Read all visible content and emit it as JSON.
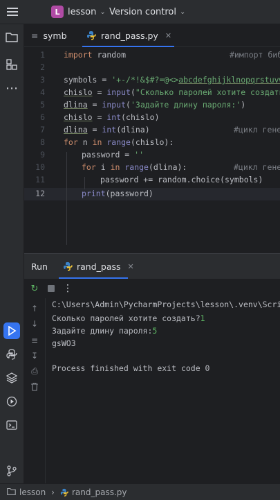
{
  "titlebar": {
    "project_initial": "L",
    "project_name": "lesson",
    "vcs_label": "Version control"
  },
  "editor_tabs": [
    {
      "label": "symb",
      "active": false
    },
    {
      "label": "rand_pass.py",
      "active": true
    }
  ],
  "code": {
    "current_line": 12,
    "line_numbers": [
      "1",
      "2",
      "3",
      "4",
      "5",
      "6",
      "7",
      "8",
      "9",
      "10",
      "11",
      "12"
    ],
    "lines": {
      "l1_kw": "import",
      "l1_mod": " random",
      "l1_comment": "#импорт биб",
      "l3_var": "symbols = ",
      "l3_str_plain": "'+-/*!&$#?=@<>",
      "l3_str_ul": "abcdefghijklnopqrstuvwx",
      "l4_var": "chislo",
      "l4_eq": " = ",
      "l4_fn": "input",
      "l4_str": "\"Сколько паролей хотите создать?",
      "l5_var": "dlina",
      "l5_eq": " = ",
      "l5_fn": "input",
      "l5_str": "'Задайте длину пароля:'",
      "l5_close": ")",
      "l6_var": "chislo",
      "l6_eq": " = ",
      "l6_fn": "int",
      "l6_arg": "(chislo)",
      "l7_var": "dlina",
      "l7_eq": " = ",
      "l7_fn": "int",
      "l7_arg": "(dlina)",
      "l7_comment": "#цикл гене",
      "l8_for": "for",
      "l8_n": " n ",
      "l8_in": "in",
      "l8_range": " range",
      "l8_arg": "(chislo):",
      "l9_code": "password = ",
      "l9_str": "''",
      "l10_for": "for",
      "l10_i": " i ",
      "l10_in": "in",
      "l10_range": " range",
      "l10_arg": "(dlina):",
      "l10_comment": "#цикл гене",
      "l11_code": "password += random.choice(symbols)",
      "l12_fn": "print",
      "l12_arg": "(password)"
    }
  },
  "run": {
    "title": "Run",
    "tab_label": "rand_pass",
    "output": {
      "path": "C:\\Users\\Admin\\PycharmProjects\\lesson\\.venv\\Script",
      "q1": "Сколько паролей хотите создать?",
      "a1": "1",
      "q2": "Задайте длину пароля:",
      "a2": "5",
      "password": "gsWO3",
      "finished": "Process finished with exit code 0"
    }
  },
  "statusbar": {
    "project": "lesson",
    "file": "rand_pass.py"
  },
  "colors": {
    "accent": "#3574f0",
    "keyword": "#cf8e6d",
    "string": "#6aab73",
    "comment": "#7a7e85",
    "input_echo": "#5fb865"
  },
  "icons": {
    "hamburger": "menu-icon",
    "project": "folder-icon",
    "structure": "structure-icon",
    "more": "more-icon",
    "run": "run-icon",
    "python": "python-console-icon",
    "layers": "layers-icon",
    "services": "services-icon",
    "terminal": "terminal-icon",
    "git": "git-icon"
  }
}
